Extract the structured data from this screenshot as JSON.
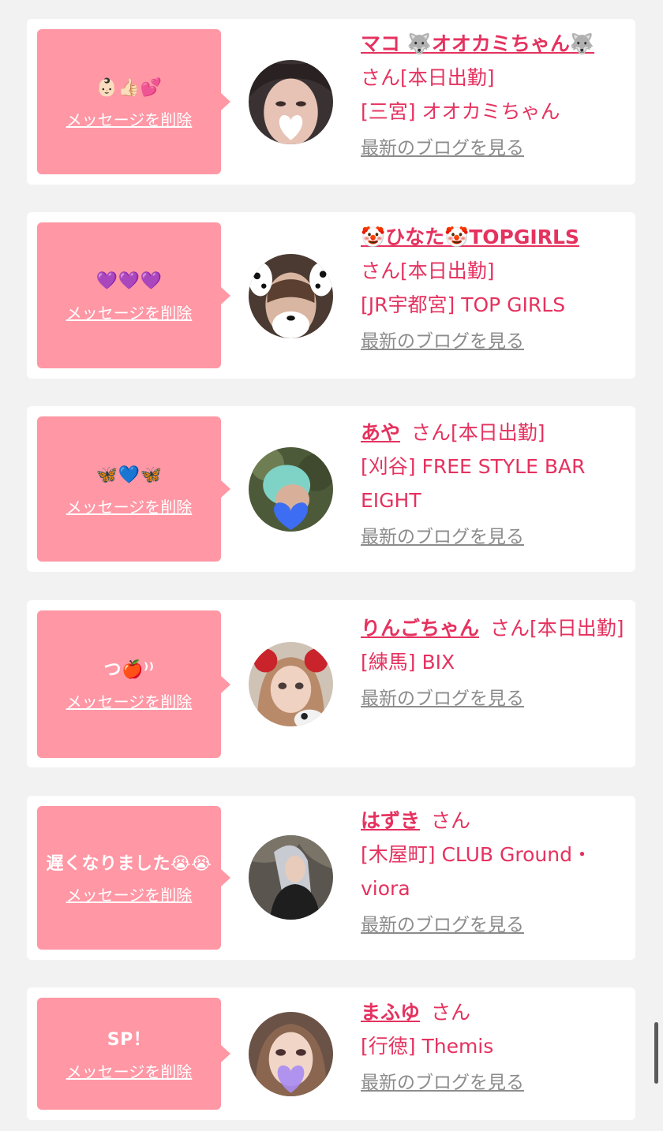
{
  "delete_label": "メッセージを削除",
  "blog_label": "最新のブログを見る",
  "san_label": "さん",
  "today_label": "[本日出勤]",
  "colors": {
    "accent": "#e5325f",
    "bubble": "#ff97a5",
    "background": "#f2f2f2"
  },
  "entries": [
    {
      "message": "👶🏻👍🏻💕",
      "name": "マコ 🐺オオカミちゃん🐺",
      "today": "[本日出勤]",
      "shop": "[三宮] オオカミちゃん",
      "avatar_icon": "heart-sticker-photo"
    },
    {
      "message": "💜💜💜",
      "name": "🤡ひなた🤡TOPGIRLS",
      "today": "[本日出勤]",
      "shop": "[JR宇都宮] TOP GIRLS",
      "avatar_icon": "dalmatian-filter-photo"
    },
    {
      "message": "🦋💙🦋",
      "name": "あや",
      "today": "[本日出勤]",
      "shop": "[刈谷] FREE STYLE BAR EIGHT",
      "avatar_icon": "blue-heart-photo"
    },
    {
      "message": "つ🍎⁾⁾",
      "name": "りんごちゃん",
      "today": "[本日出勤]",
      "shop": "[練馬] BIX",
      "avatar_icon": "red-ribbon-photo"
    },
    {
      "message": "遅くなりました😭😭",
      "name": "はずき",
      "today": "",
      "shop": "[木屋町] CLUB Ground・viora",
      "avatar_icon": "silver-hair-photo"
    },
    {
      "message": "SP！",
      "name": "まふゆ",
      "today": "",
      "shop": "[行徳] Themis",
      "avatar_icon": "purple-heart-photo"
    }
  ]
}
